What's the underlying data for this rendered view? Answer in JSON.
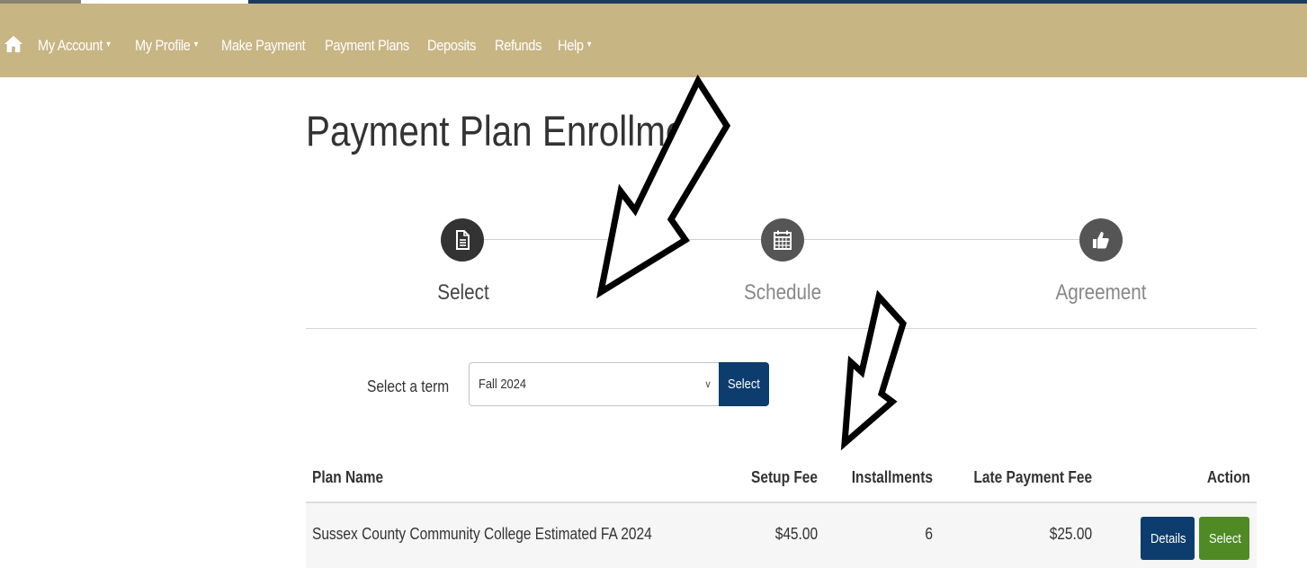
{
  "nav": {
    "items": [
      {
        "label": "My Account",
        "dropdown": true
      },
      {
        "label": "My Profile",
        "dropdown": true
      },
      {
        "label": "Make Payment",
        "dropdown": false
      },
      {
        "label": "Payment Plans",
        "dropdown": false
      },
      {
        "label": "Deposits",
        "dropdown": false
      },
      {
        "label": "Refunds",
        "dropdown": false
      },
      {
        "label": "Help",
        "dropdown": true
      }
    ],
    "caret": "▼",
    "home_icon": "home-icon",
    "bar_color": "#c8b584"
  },
  "page": {
    "title": "Payment Plan Enrollment"
  },
  "steps": [
    {
      "label": "Select",
      "icon": "document-icon",
      "active": true
    },
    {
      "label": "Schedule",
      "icon": "calendar-icon",
      "active": false
    },
    {
      "label": "Agreement",
      "icon": "thumbs-up-icon",
      "active": false
    }
  ],
  "term": {
    "label": "Select a term",
    "selected": "Fall 2024",
    "button_label": "Select"
  },
  "table": {
    "columns": [
      "Plan Name",
      "Setup Fee",
      "Installments",
      "Late Payment Fee",
      "Action"
    ],
    "rows": [
      {
        "plan_name": "Sussex County Community College Estimated FA 2024",
        "setup_fee": "$45.00",
        "installments": "6",
        "late_payment_fee": "$25.00",
        "details_label": "Details",
        "select_label": "Select"
      }
    ]
  },
  "colors": {
    "primary_button": "#0d3d6e",
    "success_button": "#4f8a25"
  }
}
